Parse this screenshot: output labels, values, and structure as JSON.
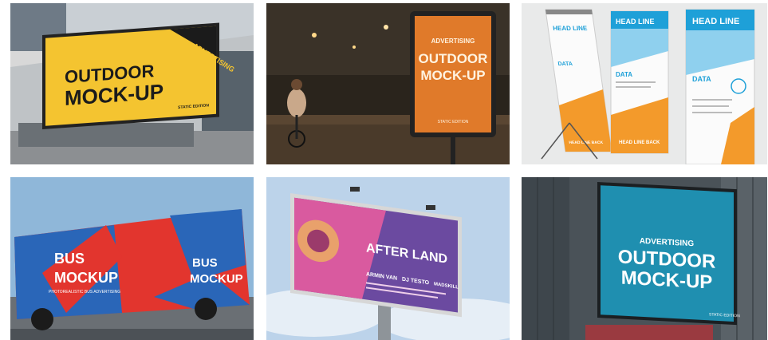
{
  "gallery": {
    "items": [
      {
        "name": "outdoor-billboard-yellow",
        "board_lines": [
          "ADVERTISING",
          "OUTDOOR",
          "MOCK-UP",
          "STATIC EDITION"
        ],
        "colors": {
          "board": "#f4c430",
          "sky": "#c8d0d8",
          "building": "#d9d9d9"
        }
      },
      {
        "name": "city-lightbox-orange",
        "board_lines": [
          "ADVERTISING",
          "OUTDOOR",
          "MOCK-UP",
          "STATIC EDITION"
        ],
        "colors": {
          "board": "#e07a2a",
          "night": "#2a2318"
        }
      },
      {
        "name": "rollup-banners",
        "banners": [
          {
            "headline": "HEAD LINE",
            "label": "DATA",
            "footer": "HEAD LINE BACK"
          },
          {
            "headline": "HEAD LINE",
            "label": "DATA",
            "footer": "HEAD LINE BACK"
          },
          {
            "headline": "HEAD LINE",
            "label": "DATA",
            "footer": ""
          }
        ],
        "colors": {
          "accent": "#1ea0d8",
          "secondary": "#f39a2b",
          "bg": "#e9eaea"
        }
      },
      {
        "name": "bus-mockup",
        "board_lines": [
          "BUS",
          "MOCKUP",
          "PHOTOREALISTIC BUS ADVERTISING",
          "BUS",
          "MOCKUP"
        ],
        "colors": {
          "red": "#e2352e",
          "blue": "#2a66b8",
          "sky": "#8fb7d9"
        }
      },
      {
        "name": "event-billboard",
        "board_lines": [
          "AFTER LAND",
          "ARMIN VAN",
          "DJ TESTO",
          "MADSKILL"
        ],
        "colors": {
          "pink": "#d95a9f",
          "purple": "#6b4aa0",
          "sky": "#bcd3ea"
        }
      },
      {
        "name": "building-billboard-teal",
        "board_lines": [
          "ADVERTISING",
          "OUTDOOR",
          "MOCK-UP",
          "STATIC EDITION"
        ],
        "colors": {
          "board": "#1f8fb0",
          "building": "#4a5258"
        }
      }
    ]
  }
}
